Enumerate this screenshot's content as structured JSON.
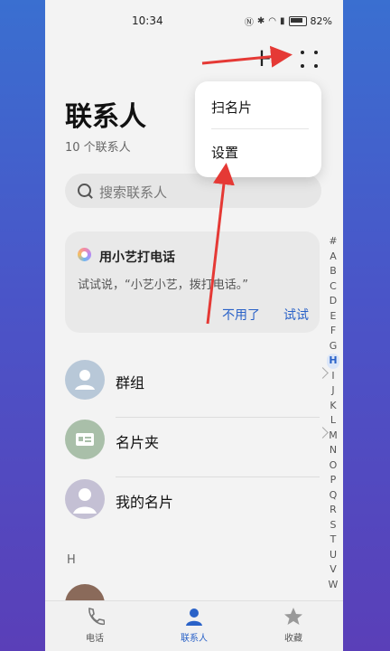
{
  "status_bar": {
    "time": "10:34",
    "battery": "82%"
  },
  "header": {
    "title": "联系人",
    "count": "10 个联系人"
  },
  "search": {
    "placeholder": "搜索联系人"
  },
  "assistant_card": {
    "title": "用小艺打电话",
    "body": "试试说，“小艺小艺，拨打电话。”",
    "decline": "不用了",
    "try": "试试"
  },
  "rows": [
    {
      "label": "群组"
    },
    {
      "label": "名片夹"
    },
    {
      "label": "我的名片"
    }
  ],
  "section_header": "H",
  "index_letters": [
    "#",
    "A",
    "B",
    "C",
    "D",
    "E",
    "F",
    "G",
    "H",
    "I",
    "J",
    "K",
    "L",
    "M",
    "N",
    "O",
    "P",
    "Q",
    "R",
    "S",
    "T",
    "U",
    "V",
    "W"
  ],
  "index_active": "H",
  "popup_menu": {
    "items": [
      "扫名片",
      "设置"
    ]
  },
  "bottom_nav": [
    {
      "label": "电话"
    },
    {
      "label": "联系人"
    },
    {
      "label": "收藏"
    }
  ],
  "colors": {
    "accent": "#2a62c8",
    "annotation": "#e53935"
  }
}
